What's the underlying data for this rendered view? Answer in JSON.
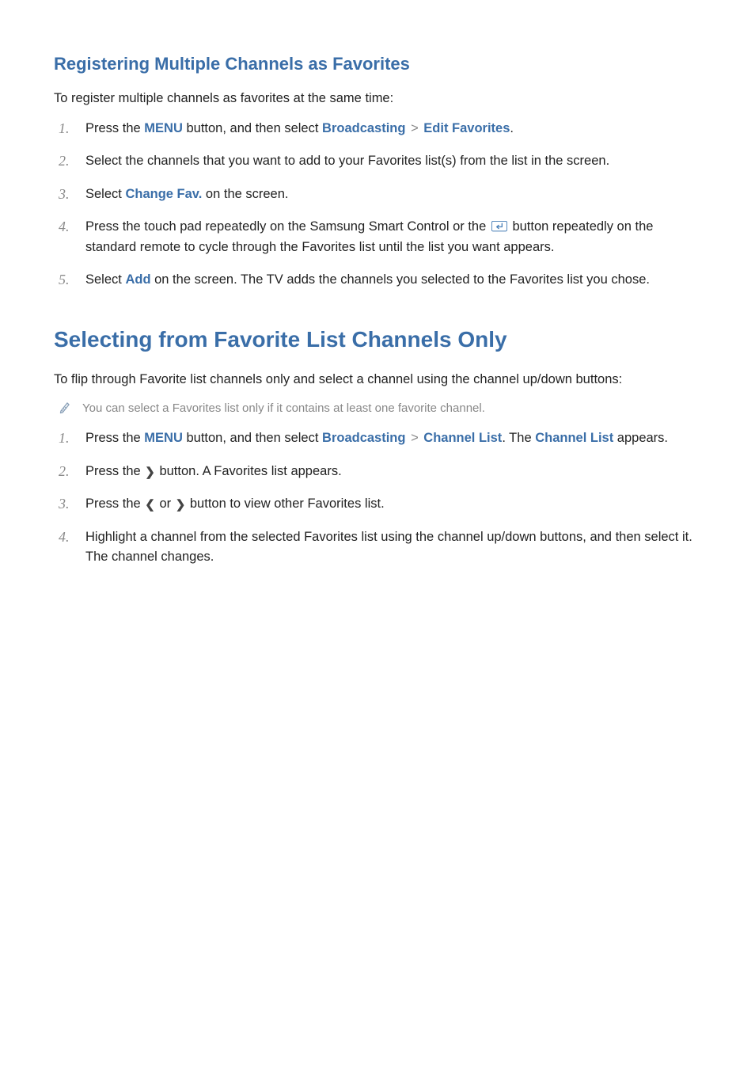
{
  "section1": {
    "title": "Registering Multiple Channels as Favorites",
    "lead": "To register multiple channels as favorites at the same time:",
    "steps": {
      "s1a": "Press the ",
      "s1_menu": "MENU",
      "s1b": " button, and then select ",
      "s1_broadcasting": "Broadcasting",
      "s1_sep": ">",
      "s1_editfav": "Edit Favorites",
      "s1c": ".",
      "s2": "Select the channels that you want to add to your Favorites list(s) from the list in the screen.",
      "s3a": "Select ",
      "s3_changefav": "Change Fav.",
      "s3b": " on the screen.",
      "s4a": "Press the touch pad repeatedly on the Samsung Smart Control or the ",
      "s4b": " button repeatedly on the standard remote to cycle through the Favorites list until the list you want appears.",
      "s5a": "Select ",
      "s5_add": "Add",
      "s5b": " on the screen. The TV adds the channels you selected to the Favorites list you chose."
    }
  },
  "section2": {
    "title": "Selecting from Favorite List Channels Only",
    "lead": "To flip through Favorite list channels only and select a channel using the channel up/down buttons:",
    "note": "You can select a Favorites list only if it contains at least one favorite channel.",
    "steps": {
      "s1a": "Press the ",
      "s1_menu": "MENU",
      "s1b": " button, and then select ",
      "s1_broadcasting": "Broadcasting",
      "s1_sep": ">",
      "s1_chlist": "Channel List",
      "s1c": ". The ",
      "s1_chlist2": "Channel List",
      "s1d": " appears.",
      "s2a": "Press the ",
      "s2b": " button. A Favorites list appears.",
      "s3a": "Press the ",
      "s3b": " or ",
      "s3c": " button to view other Favorites list.",
      "s4": "Highlight a channel from the selected Favorites list using the channel up/down buttons, and then select it. The channel changes."
    }
  },
  "glyphs": {
    "chev_right": "❯",
    "chev_left": "❮"
  }
}
